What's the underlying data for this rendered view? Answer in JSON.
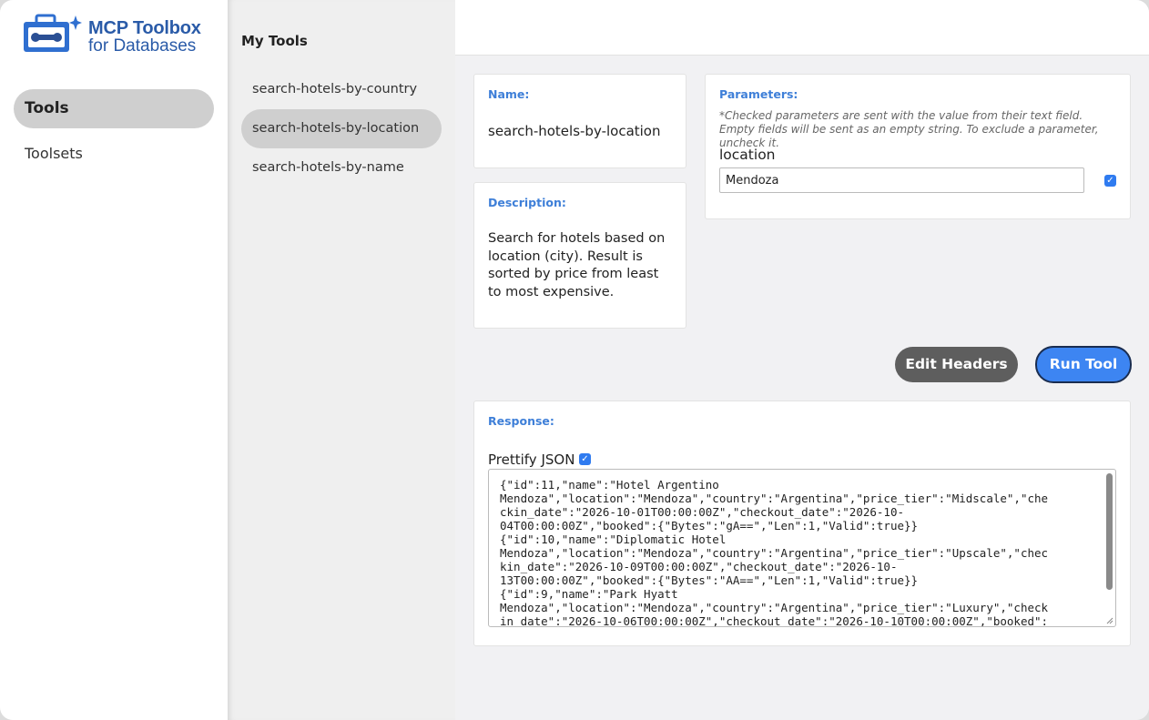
{
  "app": {
    "logo_title": "MCP Toolbox",
    "logo_subtitle": "for Databases"
  },
  "nav": {
    "items": [
      {
        "label": "Tools",
        "active": true
      },
      {
        "label": "Toolsets",
        "active": false
      }
    ]
  },
  "tool_list": {
    "title": "My Tools",
    "items": [
      {
        "label": "search-hotels-by-country",
        "active": false
      },
      {
        "label": "search-hotels-by-location",
        "active": true
      },
      {
        "label": "search-hotels-by-name",
        "active": false
      }
    ]
  },
  "tool": {
    "name_label": "Name:",
    "name": "search-hotels-by-location",
    "description_label": "Description:",
    "description": "Search for hotels based on location (city). Result is sorted by price from least to most expensive."
  },
  "parameters": {
    "label": "Parameters:",
    "note": "*Checked parameters are sent with the value from their text field. Empty fields will be sent as an empty string. To exclude a parameter, uncheck it.",
    "items": [
      {
        "name": "location",
        "value": "Mendoza",
        "checked": true
      }
    ]
  },
  "actions": {
    "edit_headers": "Edit Headers",
    "run_tool": "Run Tool"
  },
  "response": {
    "label": "Response:",
    "prettify_label": "Prettify JSON",
    "prettify_checked": true,
    "text": "{\"id\":11,\"name\":\"Hotel Argentino\nMendoza\",\"location\":\"Mendoza\",\"country\":\"Argentina\",\"price_tier\":\"Midscale\",\"che\nckin_date\":\"2026-10-01T00:00:00Z\",\"checkout_date\":\"2026-10-\n04T00:00:00Z\",\"booked\":{\"Bytes\":\"gA==\",\"Len\":1,\"Valid\":true}}\n{\"id\":10,\"name\":\"Diplomatic Hotel\nMendoza\",\"location\":\"Mendoza\",\"country\":\"Argentina\",\"price_tier\":\"Upscale\",\"chec\nkin_date\":\"2026-10-09T00:00:00Z\",\"checkout_date\":\"2026-10-\n13T00:00:00Z\",\"booked\":{\"Bytes\":\"AA==\",\"Len\":1,\"Valid\":true}}\n{\"id\":9,\"name\":\"Park Hyatt\nMendoza\",\"location\":\"Mendoza\",\"country\":\"Argentina\",\"price_tier\":\"Luxury\",\"check\nin_date\":\"2026-10-06T00:00:00Z\",\"checkout_date\":\"2026-10-10T00:00:00Z\",\"booked\":"
  },
  "colors": {
    "accent": "#3d85f2",
    "label_blue": "#3e7fd8",
    "logo_blue": "#2a5ba8",
    "edit_button": "#5e5e5e"
  }
}
